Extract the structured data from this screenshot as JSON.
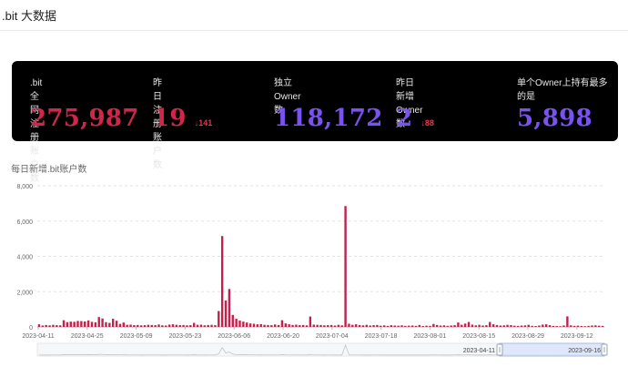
{
  "header": {
    "title": ".bit 大数据"
  },
  "stats": [
    {
      "label": ".bit全网注册账户数",
      "value": "275,987",
      "color": "#d1264a"
    },
    {
      "label": "昨日注册账户数",
      "value": "19",
      "delta": "↓141",
      "color": "#d1264a"
    },
    {
      "label": "独立Owner数",
      "value": "118,172",
      "color": "#7b52f2"
    },
    {
      "label": "昨日新增Owner数",
      "value": "2",
      "delta": "↓88",
      "color": "#7b52f2"
    },
    {
      "label": "单个Owner上持有最多的是",
      "value": "5,898",
      "color": "#7b52f2"
    }
  ],
  "chart_title": "每日新增.bit账户数",
  "colors": {
    "bar": "#c2214c",
    "delta": "#e8364f",
    "slider_fill": "#d7e3fb",
    "slider_border": "#a9bedc"
  },
  "chart_data": {
    "type": "bar",
    "title": "每日新增.bit账户数",
    "x_start": "2023-04-11",
    "x_end": "2023-09-16",
    "ylim": [
      0,
      8000
    ],
    "yticks": [
      0,
      2000,
      4000,
      6000,
      8000
    ],
    "ytick_labels": [
      "0",
      "2,000",
      "4,000",
      "6,000",
      "8,000"
    ],
    "xtick_labels": [
      "2023-04-11",
      "2023-04-25",
      "2023-05-09",
      "2023-05-23",
      "2023-06-06",
      "2023-06-20",
      "2023-07-04",
      "2023-07-18",
      "2023-08-01",
      "2023-08-15",
      "2023-08-29",
      "2023-09-12"
    ],
    "grid": "horizontal dashed",
    "values": [
      150,
      80,
      110,
      90,
      120,
      100,
      90,
      380,
      270,
      300,
      290,
      340,
      330,
      310,
      370,
      290,
      260,
      560,
      480,
      270,
      230,
      460,
      350,
      170,
      250,
      120,
      130,
      100,
      110,
      90,
      100,
      120,
      110,
      100,
      140,
      90,
      80,
      130,
      150,
      120,
      100,
      110,
      90,
      100,
      230,
      120,
      130,
      90,
      110,
      120,
      100,
      900,
      5150,
      1500,
      2150,
      680,
      460,
      360,
      300,
      250,
      200,
      180,
      150,
      160,
      120,
      110,
      100,
      140,
      110,
      380,
      200,
      150,
      110,
      130,
      100,
      110,
      90,
      590,
      130,
      120,
      110,
      90,
      100,
      110,
      80,
      120,
      90,
      6850,
      180,
      120,
      150,
      110,
      90,
      120,
      80,
      100,
      110,
      70,
      90,
      60,
      100,
      80,
      70,
      90,
      60,
      70,
      80,
      60,
      110,
      50,
      70,
      60,
      170,
      110,
      80,
      90,
      60,
      80,
      100,
      250,
      120,
      190,
      280,
      130,
      90,
      120,
      80,
      100,
      280,
      150,
      110,
      80,
      90,
      120,
      100,
      70,
      60,
      80,
      90,
      120,
      60,
      50,
      80,
      130,
      150,
      100,
      60,
      50,
      40,
      80,
      600,
      90,
      60,
      70,
      50,
      40,
      60,
      80,
      90,
      70,
      60
    ],
    "highlighted_index": 149
  },
  "data_zoom": {
    "start_label": "2023-04-11",
    "end_label": "2023-09-16"
  }
}
